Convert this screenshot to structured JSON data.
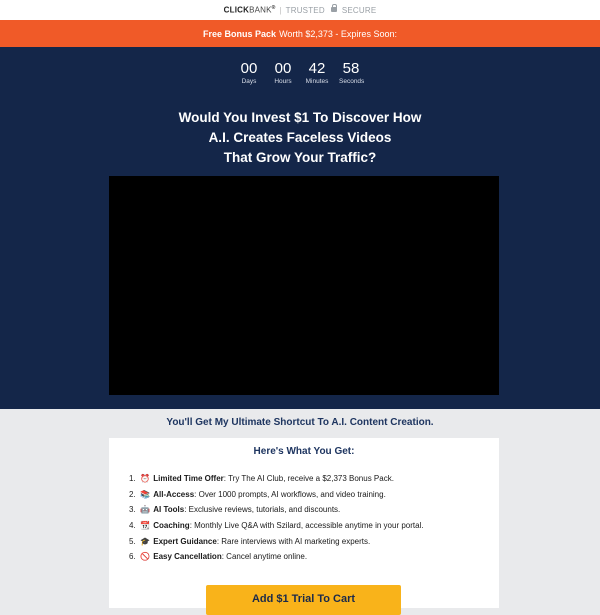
{
  "topbar": {
    "brand_bold": "CLICK",
    "brand_light": "BANK",
    "brand_mark": "®",
    "separator": "|",
    "trusted": "TRUSTED",
    "secure": "SECURE"
  },
  "banner": {
    "bold": "Free Bonus Pack",
    "text": "Worth $2,373 - Expires Soon:"
  },
  "countdown": [
    {
      "value": "00",
      "label": "Days"
    },
    {
      "value": "00",
      "label": "Hours"
    },
    {
      "value": "42",
      "label": "Minutes"
    },
    {
      "value": "58",
      "label": "Seconds"
    }
  ],
  "headline": {
    "line1": "Would You Invest $1 To Discover How",
    "line2": "A.I. Creates Faceless Videos",
    "line3": "That Grow Your Traffic?"
  },
  "subhead": "You'll Get My Ultimate Shortcut To A.I. Content Creation.",
  "card": {
    "title": "Here's What You Get:",
    "items": [
      {
        "num": "1.",
        "emoji": "⏰",
        "bold": "Limited Time Offer",
        "text": ": Try The AI Club, receive a $2,373 Bonus Pack."
      },
      {
        "num": "2.",
        "emoji": "📚",
        "bold": "All-Access",
        "text": ": Over 1000 prompts, AI workflows, and video training."
      },
      {
        "num": "3.",
        "emoji": "🤖",
        "bold": "AI Tools",
        "text": ": Exclusive reviews, tutorials, and discounts."
      },
      {
        "num": "4.",
        "emoji": "📆",
        "bold": "Coaching",
        "text": ": Monthly Live Q&A with Szilard, accessible anytime in your portal."
      },
      {
        "num": "5.",
        "emoji": "🎓",
        "bold": "Expert Guidance",
        "text": ": Rare interviews with AI marketing experts."
      },
      {
        "num": "6.",
        "emoji": "🚫",
        "bold": "Easy Cancellation",
        "text": ": Cancel anytime online."
      }
    ]
  },
  "cta": {
    "label": "Add $1 Trial To Cart"
  },
  "colors": {
    "banner": "#f05a28",
    "hero": "#142649",
    "cta": "#f9b31a",
    "heading": "#1e3560"
  }
}
